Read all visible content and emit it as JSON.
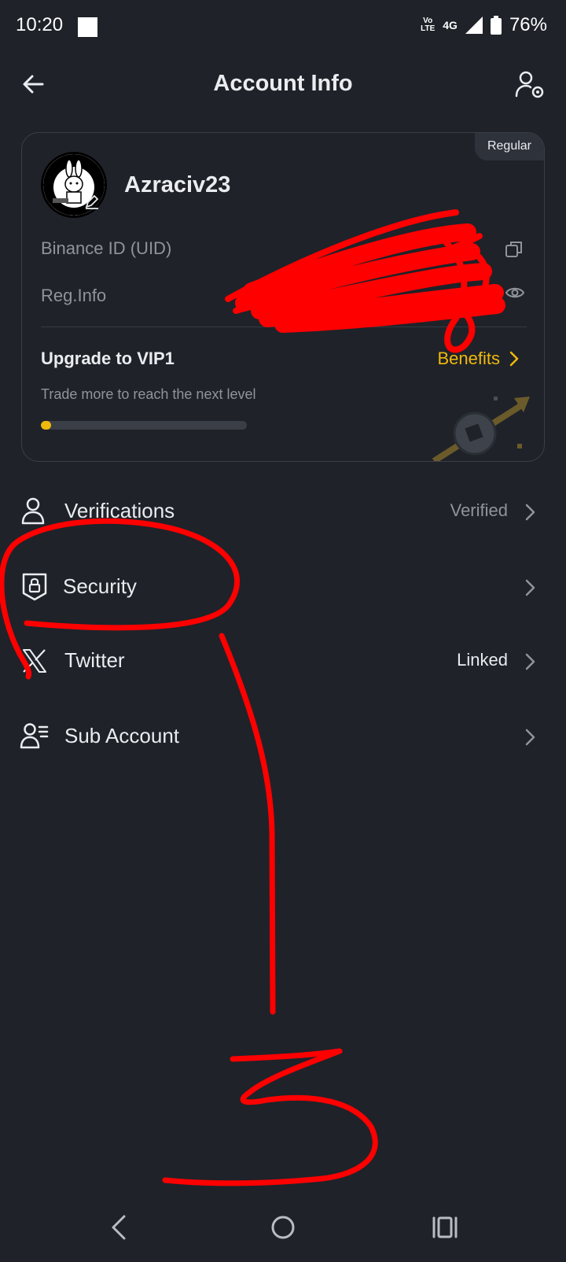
{
  "status_bar": {
    "time": "10:20",
    "volte_top": "Vo",
    "volte_bottom": "LTE",
    "network": "4G",
    "battery": "76%"
  },
  "header": {
    "title": "Account Info",
    "back_icon": "arrow-left-icon",
    "settings_icon": "user-settings-icon"
  },
  "profile_card": {
    "tier_badge": "Regular",
    "username": "Azraciv23",
    "uid_label": "Binance ID (UID)",
    "reg_label": "Reg.Info",
    "vip_title": "Upgrade to VIP1",
    "benefits_label": "Benefits",
    "vip_subtitle": "Trade more to reach the next level",
    "vip_progress": 0.05
  },
  "menu": {
    "items": [
      {
        "label": "Verifications",
        "status": "Verified",
        "icon": "user-icon"
      },
      {
        "label": "Security",
        "status": "",
        "icon": "shield-lock-icon"
      },
      {
        "label": "Twitter",
        "status": "Linked",
        "icon": "x-logo-icon"
      },
      {
        "label": "Sub Account",
        "status": "",
        "icon": "user-list-icon"
      }
    ]
  },
  "colors": {
    "background": "#1f2229",
    "accent": "#f0b90b",
    "text_primary": "#eaecef",
    "text_secondary": "#8f949c",
    "annotation": "#ff0000"
  },
  "annotation": {
    "text": "3"
  }
}
